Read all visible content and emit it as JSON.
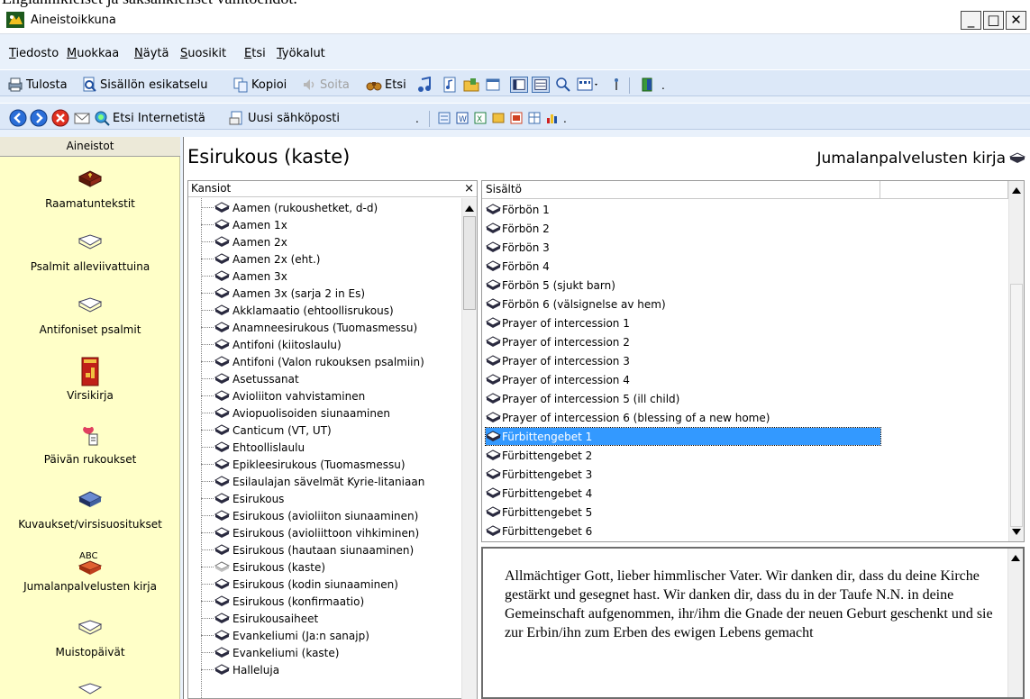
{
  "doc_caption": "Englannikielset ja saksankieliset vaihtoehdot.",
  "window": {
    "title": "Aineistoikkuna",
    "minimize": "_",
    "maximize": "□",
    "close": "✕"
  },
  "menu": [
    {
      "key": "T",
      "rest": "iedosto"
    },
    {
      "key": "M",
      "rest": "uokkaa"
    },
    {
      "key": "N",
      "rest": "äytä"
    },
    {
      "key": "S",
      "rest": "uosikit"
    },
    {
      "key": "E",
      "rest": "tsi"
    },
    {
      "key": "T",
      "rest": "yökalut"
    }
  ],
  "toolbar1": {
    "print": "Tulosta",
    "preview": "Sisällön esikatselu",
    "copy": "Kopioi",
    "play": "Soita",
    "search": "Etsi"
  },
  "toolbar2": {
    "web_search": "Etsi Internetistä",
    "new_email": "Uusi sähköposti"
  },
  "sidebar": {
    "header": "Aineistot",
    "items": [
      "Raamatuntekstit",
      "Psalmit alleviivattuina",
      "Antifoniset psalmit",
      "Virsikirja",
      "Päivän rukoukset",
      "Kuvaukset/virsisuositukset",
      "Jumalanpalvelusten kirja",
      "Muistopäivät"
    ],
    "abc_label": "ABC"
  },
  "main": {
    "title": "Esirukous (kaste)",
    "book": "Jumalanpalvelusten kirja"
  },
  "folders": {
    "header": "Kansiot",
    "close": "×",
    "items": [
      "Aamen (rukoushetket, d-d)",
      "Aamen 1x",
      "Aamen 2x",
      "Aamen 2x (eht.)",
      "Aamen 3x",
      "Aamen 3x (sarja 2 in Es)",
      "Akklamaatio (ehtoollisrukous)",
      "Anamneesirukous (Tuomasmessu)",
      "Antifoni (kiitoslaulu)",
      "Antifoni (Valon rukouksen psalmiin)",
      "Asetussanat",
      "Avioliiton vahvistaminen",
      "Aviopuolisoiden siunaaminen",
      "Canticum (VT, UT)",
      "Ehtoollislaulu",
      "Epikleesirukous (Tuomasmessu)",
      "Esilaulajan sävelmät Kyrie-litaniaan",
      "Esirukous",
      "Esirukous (avioliiton siunaaminen)",
      "Esirukous (avioliittoon vihkiminen)",
      "Esirukous (hautaan siunaaminen)",
      "Esirukous (kaste)",
      "Esirukous (kodin siunaaminen)",
      "Esirukous (konfirmaatio)",
      "Esirukousaiheet",
      "Evankeliumi (Ja:n sanajp)",
      "Evankeliumi (kaste)",
      "Halleluja"
    ]
  },
  "contents": {
    "header": "Sisältö",
    "items": [
      "Förbön 1",
      "Förbön 2",
      "Förbön 3",
      "Förbön 4",
      "Förbön 5 (sjukt barn)",
      "Förbön 6 (välsignelse av hem)",
      "Prayer of intercession 1",
      "Prayer of intercession 2",
      "Prayer of intercession 3",
      "Prayer of intercession 4",
      "Prayer of intercession 5 (ill child)",
      "Prayer of intercession 6 (blessing of a new home)",
      "Fürbittengebet 1",
      "Fürbittengebet 2",
      "Fürbittengebet 3",
      "Fürbittengebet 4",
      "Fürbittengebet 5",
      "Fürbittengebet 6"
    ],
    "selected": "Fürbittengebet 1"
  },
  "text_pane": {
    "body": "Allmächtiger Gott, lieber himmlischer Vater. Wir danken dir, dass du deine Kirche gestärkt und gesegnet hast. Wir danken dir, dass du in der Taufe N.N. in deine Gemeinschaft aufgenommen, ihr/ihm die Gnade der neuen Geburt geschenkt und sie zur Erbin/ihn zum Erben des ewigen Lebens gemacht"
  },
  "colors": {
    "selection": "#3399ff",
    "sidebar_bg": "#ffffc8",
    "toolbar_bg": "#dce8f8"
  }
}
